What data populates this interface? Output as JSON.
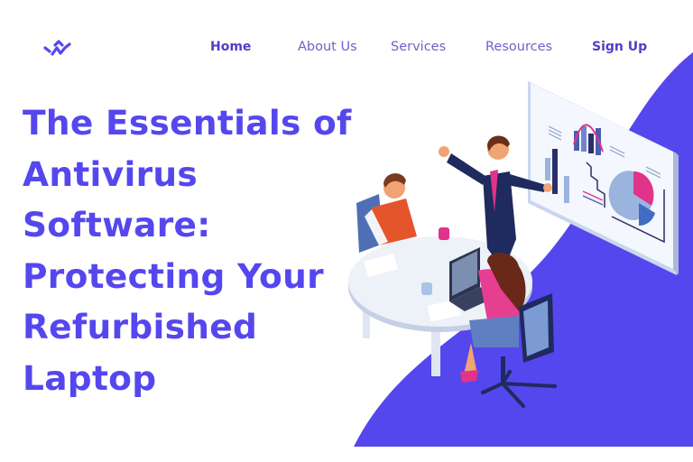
{
  "brand": {
    "logo_icon": "wave-w-logo-icon",
    "accent_color": "#5547ee"
  },
  "nav": {
    "items": [
      {
        "label": "Home",
        "bold": true
      },
      {
        "label": "About Us",
        "bold": false
      },
      {
        "label": "Services",
        "bold": false
      },
      {
        "label": "Resources",
        "bold": false
      },
      {
        "label": "Sign Up",
        "bold": true
      }
    ]
  },
  "hero": {
    "title_lines": [
      "The Essentials of",
      "Antivirus",
      "Software:",
      "Protecting Your",
      "Refurbished",
      "Laptop"
    ],
    "illustration": "office-meeting-presentation-illustration"
  }
}
